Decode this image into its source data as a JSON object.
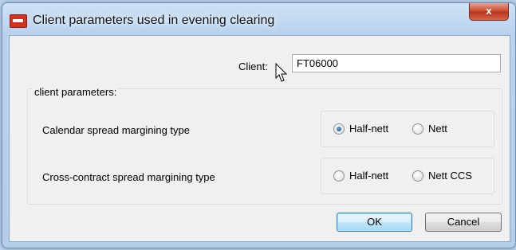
{
  "window": {
    "title": "Client parameters used in evening clearing",
    "close_label": "x"
  },
  "client": {
    "label": "Client:",
    "value": "FT06000"
  },
  "params": {
    "group_label": "client parameters:",
    "rows": [
      {
        "label": "Calendar spread margining type",
        "options": [
          {
            "label": "Half-nett",
            "selected": true
          },
          {
            "label": "Nett",
            "selected": false
          }
        ]
      },
      {
        "label": "Cross-contract spread margining type",
        "options": [
          {
            "label": "Half-nett",
            "selected": false
          },
          {
            "label": "Nett CCS",
            "selected": false
          }
        ]
      }
    ]
  },
  "buttons": {
    "ok": "OK",
    "cancel": "Cancel"
  }
}
